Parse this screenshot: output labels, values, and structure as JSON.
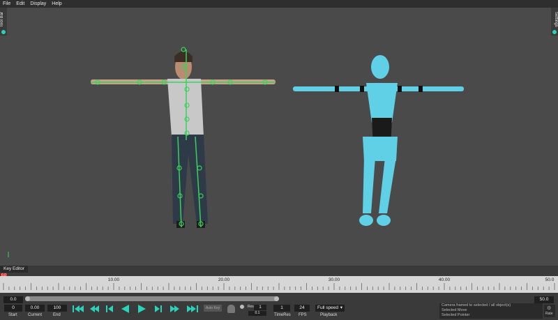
{
  "menu": {
    "file": "File",
    "edit": "Edit",
    "display": "Display",
    "help": "Help"
  },
  "left_panel": {
    "label": "Tool Bar"
  },
  "right_panel": {
    "label": "Settings"
  },
  "key_editor": {
    "tab_label": "Key Editor",
    "playhead_label": "0.0",
    "ruler_labels": [
      "10.00",
      "20.00",
      "30.00",
      "40.00",
      "50.0"
    ],
    "range_start": "0.0",
    "range_end": "50.0"
  },
  "controls": {
    "start": {
      "value": "0",
      "label": "Start"
    },
    "current": {
      "value": "0.00",
      "label": "Current"
    },
    "end": {
      "value": "100",
      "label": "End"
    },
    "auto_key": "Auto Key",
    "res_label": "Res",
    "res_value": "1",
    "res_sub": "0.1",
    "time_res": {
      "value": "1",
      "label": "TimeRes"
    },
    "fps": {
      "value": "24",
      "label": "FPS"
    },
    "playback": {
      "value": "Full speed",
      "label": "Playback"
    },
    "rate_label": "Rate"
  },
  "status_lines": [
    "Camera framed to selected / all object(s)",
    "Selected Move",
    "Selected Pointer"
  ],
  "colors": {
    "accent": "#2bd1b8",
    "rig": "#39d35a",
    "robot": "#5fd0e6"
  }
}
